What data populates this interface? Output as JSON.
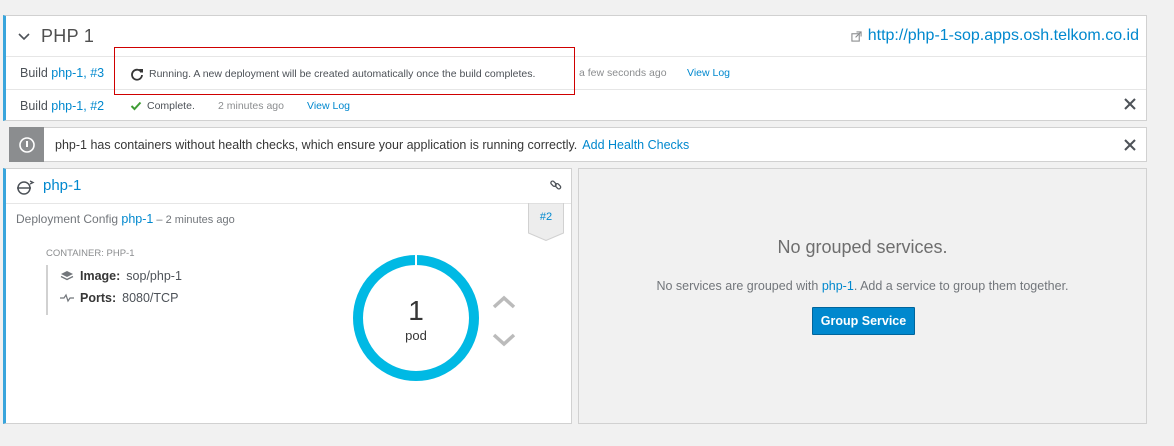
{
  "app": {
    "title": "PHP 1",
    "route_url": "http://php-1-sop.apps.osh.telkom.co.id"
  },
  "builds": [
    {
      "prefix": "Build ",
      "link": "php-1, #3",
      "status": "Running. A new deployment will be created automatically once the build completes.",
      "time": "a few seconds ago",
      "view_log": "View Log"
    },
    {
      "prefix": "Build ",
      "link": "php-1, #2",
      "status": "Complete.",
      "time": "2 minutes ago",
      "view_log": "View Log"
    }
  ],
  "alert": {
    "message": "php-1 has containers without health checks, which ensure your application is running correctly.",
    "action": "Add Health Checks"
  },
  "deployment": {
    "name": "php-1",
    "config_label": "Deployment Config ",
    "config_link": "php-1",
    "config_time": " – 2 minutes ago",
    "revision": "#2",
    "container_label": "CONTAINER: PHP-1",
    "image_label": "Image:",
    "image_value": "sop/php-1",
    "ports_label": "Ports:",
    "ports_value": "8080/TCP",
    "pod_count": "1",
    "pod_unit": "pod",
    "pod_ring_fill": 1.0
  },
  "services": {
    "heading": "No grouped services.",
    "text_before": "No services are grouped with ",
    "text_link": "php-1",
    "text_after": ". Add a service to group them together.",
    "button": "Group Service"
  },
  "colors": {
    "accent": "#0088ce",
    "ring": "#00b9e4",
    "highlight": "#cf0000",
    "success": "#3f9c35"
  }
}
